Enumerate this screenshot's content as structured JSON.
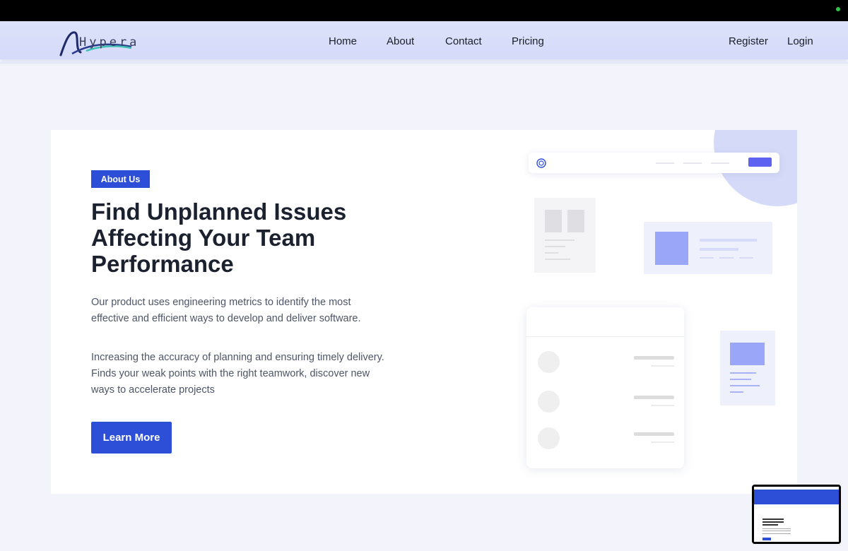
{
  "brand": {
    "logo_text": "Hypera"
  },
  "nav": {
    "links": [
      {
        "label": "Home"
      },
      {
        "label": "About"
      },
      {
        "label": "Contact"
      },
      {
        "label": "Pricing"
      }
    ],
    "register_label": "Register",
    "login_label": "Login"
  },
  "hero": {
    "badge": "About Us",
    "title": "Find Unplanned Issues Affecting Your Team Performance",
    "paragraph_1": "Our product uses engineering metrics to identify the most effective and efficient ways to develop and deliver software.",
    "paragraph_2": "Increasing the accuracy of planning and ensuring timely delivery. Finds your weak points with the right teamwork, discover new ways to accelerate projects",
    "cta_label": "Learn More"
  },
  "colors": {
    "accent": "#2d4fd8",
    "navbar_bg": "#d9defa",
    "illustration_accent": "#5d63f0",
    "illustration_light": "#9aa6f7"
  },
  "icons": {
    "logo": "hypera-wave-logo",
    "mock_logo": "spiral-icon"
  }
}
